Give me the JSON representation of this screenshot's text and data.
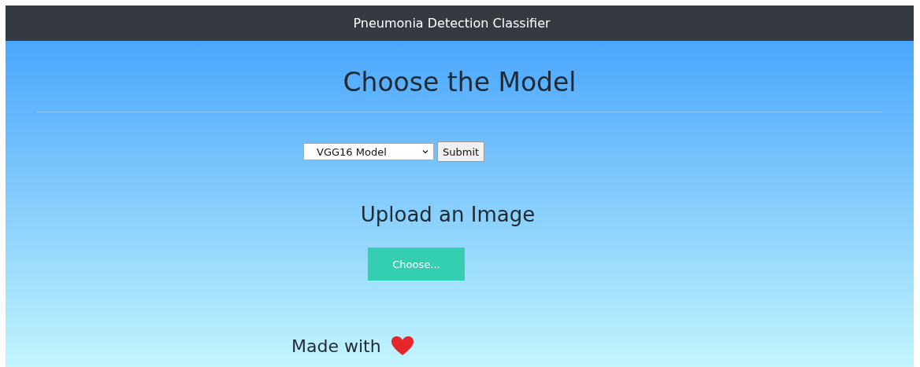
{
  "navbar": {
    "title": "Pneumonia Detection Classifier"
  },
  "model_section": {
    "heading": "Choose the Model",
    "select": {
      "value": "VGG16 Model"
    },
    "submit_button": "Submit"
  },
  "upload_section": {
    "heading": "Upload an Image",
    "choose_button": "Choose..."
  },
  "footer": {
    "text": "Made with"
  }
}
